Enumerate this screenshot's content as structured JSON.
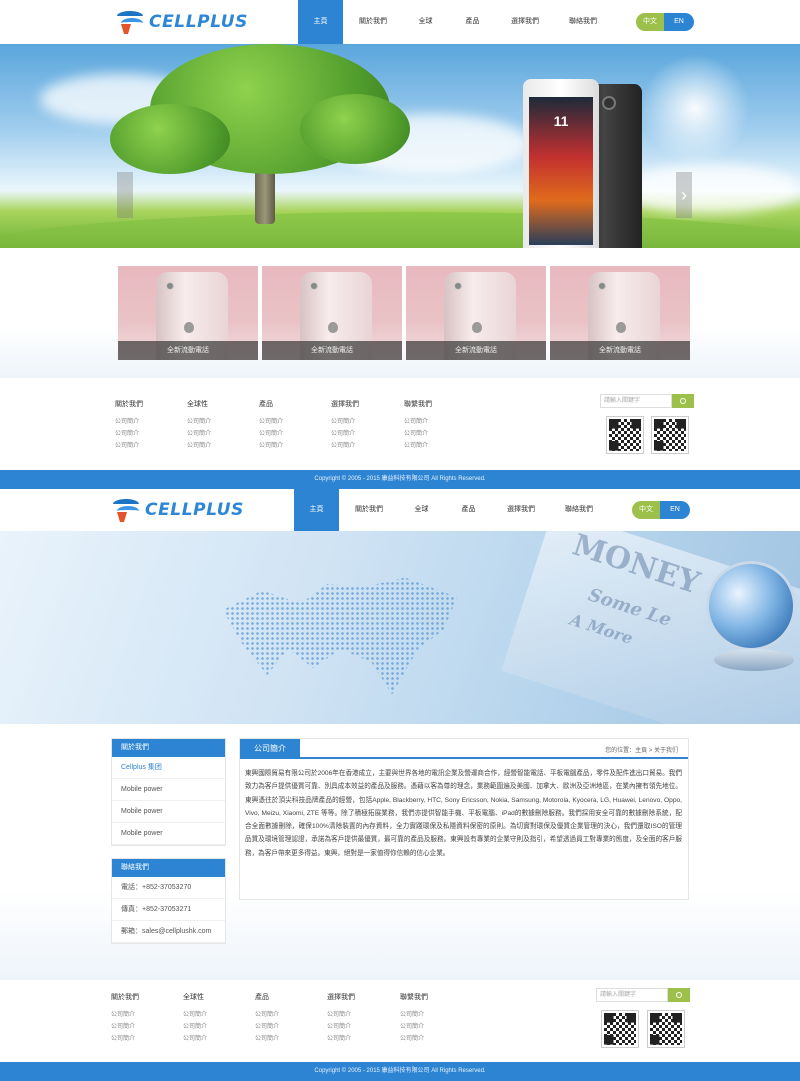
{
  "brand": {
    "name": "CELLPLUS",
    "accent": "#2c84d2",
    "lang_zh_color": "#9cc04a"
  },
  "nav": {
    "items": [
      "主頁",
      "關於我們",
      "全球",
      "產品",
      "選擇我們",
      "聯絡我們"
    ],
    "active_index": 0
  },
  "lang": {
    "zh": "中文",
    "en": "EN"
  },
  "banner1": {
    "phone_time": "11",
    "next_icon": "chevron-right-icon",
    "prev_icon": "chevron-left-icon"
  },
  "products": [
    {
      "caption": "全新流動電話"
    },
    {
      "caption": "全新流動電話"
    },
    {
      "caption": "全新流動電話"
    },
    {
      "caption": "全新流動電話"
    }
  ],
  "footer1": {
    "columns": [
      {
        "title": "關於我們",
        "links": [
          "公司簡介",
          "公司簡介",
          "公司簡介"
        ]
      },
      {
        "title": "全球性",
        "links": [
          "公司簡介",
          "公司簡介",
          "公司簡介"
        ]
      },
      {
        "title": "產品",
        "links": [
          "公司簡介",
          "公司簡介",
          "公司簡介"
        ]
      },
      {
        "title": "選擇我們",
        "links": [
          "公司簡介",
          "公司簡介",
          "公司簡介"
        ]
      },
      {
        "title": "聯繫我們",
        "links": [
          "公司簡介",
          "公司簡介",
          "公司簡介"
        ]
      }
    ],
    "search_placeholder": "請輸入關鍵字"
  },
  "footer2": {
    "columns": [
      {
        "title": "關於我們",
        "links": [
          "公司簡介",
          "公司簡介",
          "公司簡介"
        ]
      },
      {
        "title": "全球性",
        "links": [
          "公司簡介",
          "公司簡介",
          "公司簡介"
        ]
      },
      {
        "title": "產品",
        "links": [
          "公司簡介",
          "公司簡介",
          "公司簡介"
        ]
      },
      {
        "title": "選擇我們",
        "links": [
          "公司簡介",
          "公司簡介",
          "公司簡介"
        ]
      },
      {
        "title": "聯繫我們",
        "links": [
          "公司簡介",
          "公司簡介",
          "公司簡介"
        ]
      }
    ],
    "search_placeholder": "請輸入關鍵字"
  },
  "copyright": "Copyright © 2005 - 2015 康益科技有限公司 All Rights Reserved.",
  "banner2": {
    "word1": "MONEY",
    "word2": "Some Le",
    "word3": "A More"
  },
  "sidebar": {
    "about_title": "關於我們",
    "about_items": [
      "Cellplus 集团",
      "Mobile power",
      "Mobile power",
      "Mobile power"
    ],
    "active_index": 0,
    "contact_title": "聯絡我們",
    "contact_items": [
      "電話：+852-37053270",
      "傳真：+852-37053271",
      "郵箱：sales@cellplushk.com"
    ]
  },
  "main": {
    "tab": "公司簡介",
    "breadcrumb": "您的位置：主頁 > 关于我们",
    "body": "東興國際貿易有限公司於2006年在香港成立，主要與世界各地的電訊企業及營運商合作，經營智能電話、平板電腦產品，零件及配件進出口貿易。我們致力為客戶提供優質可靠、別具成本效益的產品及服務。憑藉以客為尊的理念，業務範圍遍及美國、加拿大、歐洲及亞洲地區，在業內擁有領先地位。東興憑往於頂尖科技品牌產品的經營，包括Apple, Blackberry, HTC, Sony Ericsson, Nokia, Samsung, Motorola, Kyocera, LG, Huawei, Lenovo, Oppo, Vivo, Meizu, Xiaomi, ZTE 等等。除了積極拓展業務，我們亦提供智能手機、平板電腦、iPad的數據刪除服務。我們採用安全可靠的數據刪除系統，配合全面數據刪除，確保100%清除裝置的內存資料，全力實踐環保及私隱資料保密的原則。為切實對環保及優質企業管理的決心，我們還取ISO的管理品質及環境管理認證，承諾為客戶提供最優質，最可靠的產品及服務。東興設有專業的企業守則及指引，希望透過員工對專業的態度，及全面的客戶服務，為客戶帶來更多得益。東興，絕對是一家值得你信賴的信心企業。"
  }
}
